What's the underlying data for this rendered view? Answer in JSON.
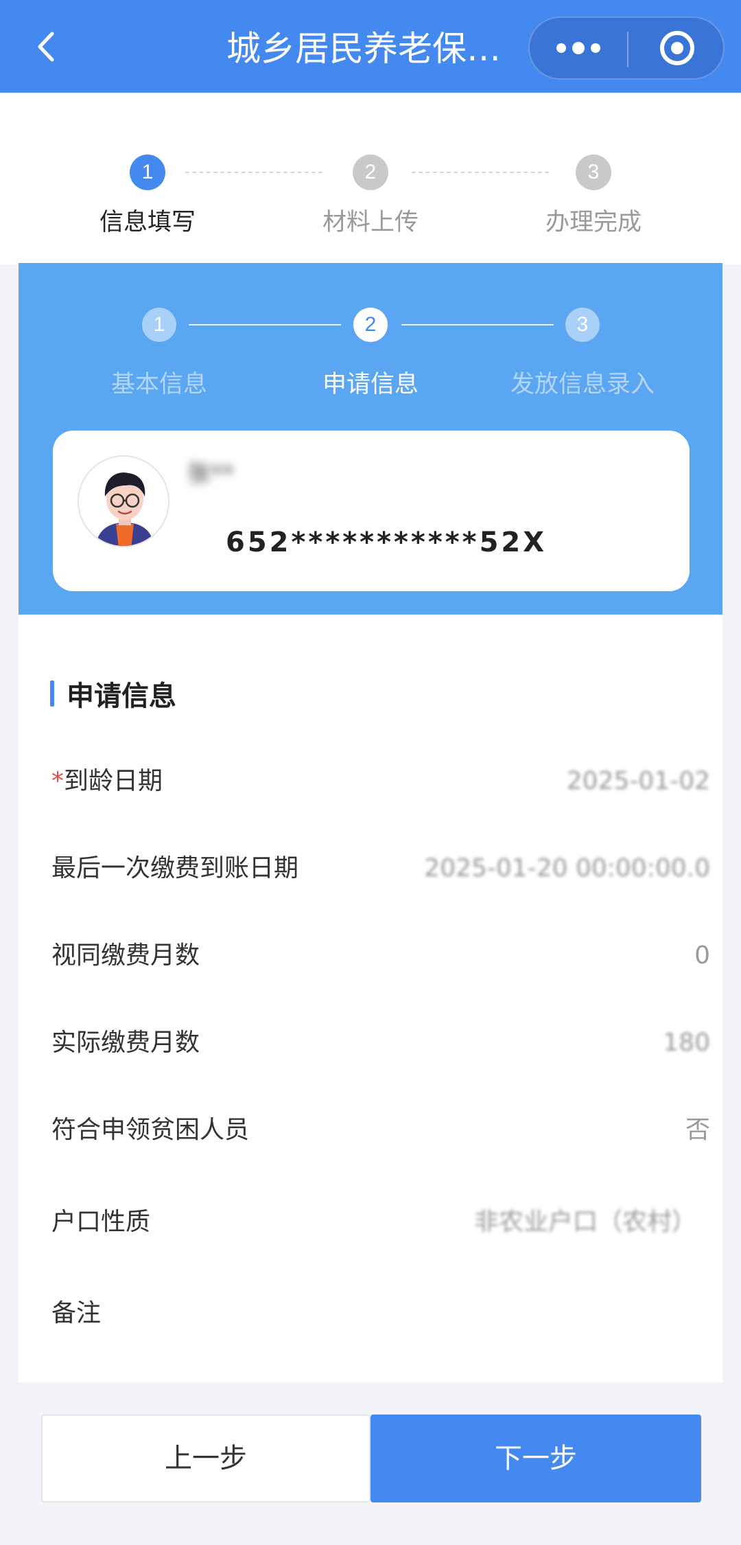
{
  "header": {
    "title": "城乡居民养老保…",
    "accent_color": "#4389ef"
  },
  "top_steps": [
    {
      "number": "1",
      "label": "信息填写",
      "state": "active"
    },
    {
      "number": "2",
      "label": "材料上传",
      "state": "pending"
    },
    {
      "number": "3",
      "label": "办理完成",
      "state": "pending"
    }
  ],
  "sub_steps": [
    {
      "number": "1",
      "label": "基本信息",
      "state": "done"
    },
    {
      "number": "2",
      "label": "申请信息",
      "state": "current"
    },
    {
      "number": "3",
      "label": "发放信息录入",
      "state": "pending"
    }
  ],
  "user": {
    "name": "张**",
    "id_number": "652***********52X"
  },
  "section": {
    "title": "申请信息"
  },
  "fields": [
    {
      "label": "到龄日期",
      "required": true,
      "value": "2025-01-02"
    },
    {
      "label": "最后一次缴费到账日期",
      "required": false,
      "value": "2025-01-20 00:00:00.0"
    },
    {
      "label": "视同缴费月数",
      "required": false,
      "value": "0"
    },
    {
      "label": "实际缴费月数",
      "required": false,
      "value": "180"
    },
    {
      "label": "符合申领贫困人员",
      "required": false,
      "value": "否"
    },
    {
      "label": "户口性质",
      "required": false,
      "value": "非农业户口（农村）"
    },
    {
      "label": "备注",
      "required": false,
      "value": ""
    }
  ],
  "buttons": {
    "prev": "上一步",
    "next": "下一步"
  }
}
